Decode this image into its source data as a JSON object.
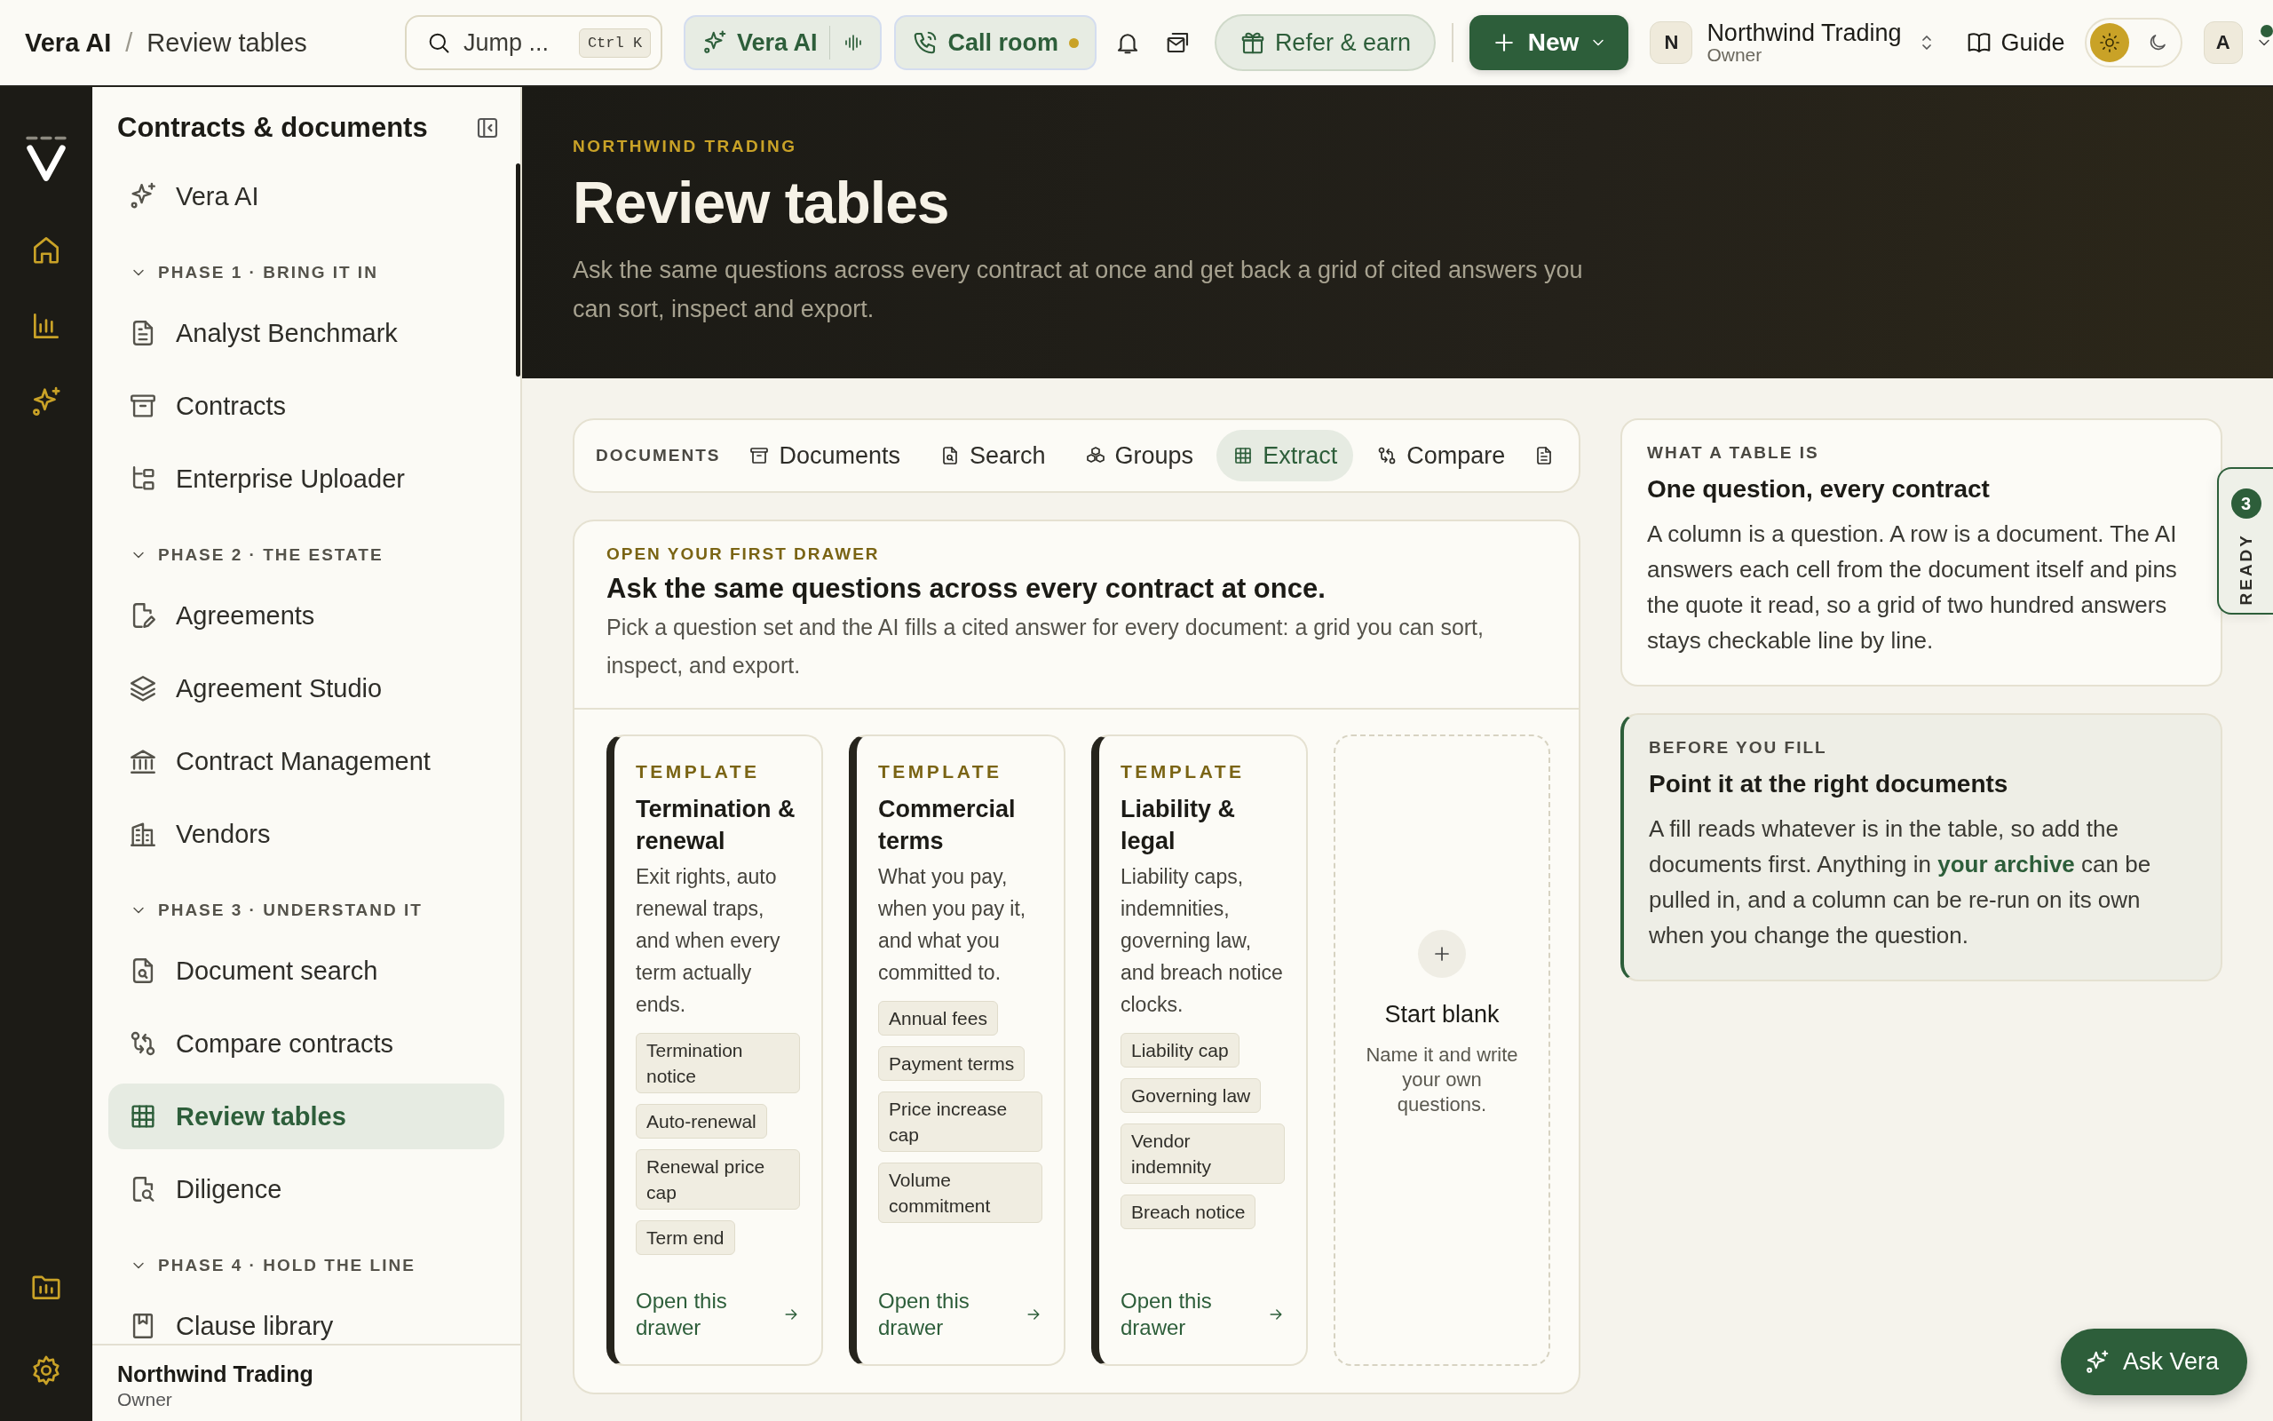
{
  "topbar": {
    "breadcrumb": {
      "parent": "Vera AI",
      "separator": "/",
      "current": "Review tables"
    },
    "search": {
      "placeholder": "Jump ...",
      "shortcut": "Ctrl K"
    },
    "assistant": {
      "label": "Vera AI"
    },
    "call_room": {
      "label": "Call room",
      "live": true
    },
    "refer": {
      "label": "Refer & earn"
    },
    "new_button": {
      "label": "New"
    },
    "workspace": {
      "initial": "N",
      "name": "Northwind Trading",
      "role": "Owner"
    },
    "guide": {
      "label": "Guide"
    },
    "theme": [
      {
        "kind": "light",
        "selected": true
      },
      {
        "kind": "dark",
        "selected": false
      }
    ],
    "account": {
      "initial": "A",
      "online": true
    }
  },
  "sidebar": {
    "title": "Contracts & documents",
    "top_items": [
      {
        "label": "Vera AI",
        "selected": false
      }
    ],
    "groups": [
      {
        "heading": "PHASE 1 · BRING IT IN",
        "expanded": true,
        "items": [
          {
            "label": "Analyst Benchmark",
            "selected": false
          },
          {
            "label": "Contracts",
            "selected": false
          },
          {
            "label": "Enterprise Uploader",
            "selected": false
          }
        ]
      },
      {
        "heading": "PHASE 2 · THE ESTATE",
        "expanded": true,
        "items": [
          {
            "label": "Agreements",
            "selected": false
          },
          {
            "label": "Agreement Studio",
            "selected": false
          },
          {
            "label": "Contract Management",
            "selected": false
          },
          {
            "label": "Vendors",
            "selected": false
          }
        ]
      },
      {
        "heading": "PHASE 3 · UNDERSTAND IT",
        "expanded": true,
        "items": [
          {
            "label": "Document search",
            "selected": false
          },
          {
            "label": "Compare contracts",
            "selected": false
          },
          {
            "label": "Review tables",
            "selected": true
          },
          {
            "label": "Diligence",
            "selected": false
          }
        ]
      },
      {
        "heading": "PHASE 4 · HOLD THE LINE",
        "expanded": true,
        "items": [
          {
            "label": "Clause library",
            "selected": false
          }
        ]
      }
    ],
    "footer": {
      "name": "Northwind Trading",
      "role": "Owner"
    }
  },
  "hero": {
    "eyebrow": "NORTHWIND TRADING",
    "title": "Review tables",
    "description": "Ask the same questions across every contract at once and get back a grid of cited answers you can sort, inspect and export."
  },
  "tabs": {
    "label": "DOCUMENTS",
    "items": [
      {
        "label": "Documents",
        "selected": false
      },
      {
        "label": "Search",
        "selected": false
      },
      {
        "label": "Groups",
        "selected": false
      },
      {
        "label": "Extract",
        "selected": true
      },
      {
        "label": "Compare",
        "selected": false
      }
    ]
  },
  "drawer": {
    "eyebrow": "OPEN YOUR FIRST DRAWER",
    "title": "Ask the same questions across every contract at once.",
    "description": "Pick a question set and the AI fills a cited answer for every document: a grid you can sort, inspect, and export.",
    "templates": [
      {
        "eyebrow": "TEMPLATE",
        "title": "Termination & renewal",
        "description": "Exit rights, auto renewal traps, and when every term actually ends.",
        "chips": [
          "Termination notice",
          "Auto-renewal",
          "Renewal price cap",
          "Term end"
        ],
        "link": "Open this drawer"
      },
      {
        "eyebrow": "TEMPLATE",
        "title": "Commercial terms",
        "description": "What you pay, when you pay it, and what you committed to.",
        "chips": [
          "Annual fees",
          "Payment terms",
          "Price increase cap",
          "Volume commitment"
        ],
        "link": "Open this drawer"
      },
      {
        "eyebrow": "TEMPLATE",
        "title": "Liability & legal",
        "description": "Liability caps, indemnities, governing law, and breach notice clocks.",
        "chips": [
          "Liability cap",
          "Governing law",
          "Vendor indemnity",
          "Breach notice"
        ],
        "link": "Open this drawer"
      }
    ],
    "blank": {
      "title": "Start blank",
      "description": "Name it and write your own questions."
    }
  },
  "info_cards": [
    {
      "kind": "plain",
      "eyebrow": "WHAT A TABLE IS",
      "title": "One question, every contract",
      "body": [
        {
          "text": "A column is a question. A row is a document. The AI answers each cell from the document itself and pins the quote it read, so a grid of two hundred answers stays checkable line by line."
        }
      ]
    },
    {
      "kind": "accent",
      "eyebrow": "BEFORE YOU FILL",
      "title": "Point it at the right documents",
      "body": [
        {
          "text": "A fill reads whatever is in the table, so add the documents first. Anything in "
        },
        {
          "text": "your archive",
          "kind": "link"
        },
        {
          "text": " can be pulled in, and a column can be re-run on its own when you change the question."
        }
      ]
    }
  ],
  "ready_tab": {
    "count": "3",
    "label": "READY"
  },
  "ask_button": {
    "label": "Ask Vera"
  }
}
